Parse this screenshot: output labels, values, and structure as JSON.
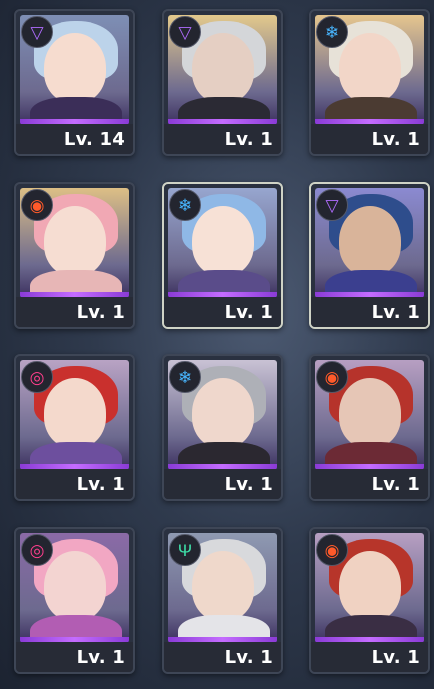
{
  "characters": [
    {
      "level": "Lv. 14",
      "element": "void-icon",
      "hair": "#bcd3ea",
      "skin": "#f6dccf",
      "body": "#3b2e58",
      "bg": "#7e8fb5"
    },
    {
      "level": "Lv. 1",
      "element": "void-icon",
      "hair": "#d4d6d9",
      "skin": "#e5cfc3",
      "body": "#2b2a34",
      "bg": "#e3c98c"
    },
    {
      "level": "Lv. 1",
      "element": "ice-icon",
      "hair": "#e7e2d8",
      "skin": "#f2d6c8",
      "body": "#4b3b32",
      "bg": "#e6c68e"
    },
    {
      "level": "Lv. 1",
      "element": "fire-icon",
      "hair": "#f1a8b4",
      "skin": "#f6ddd2",
      "body": "#e7b6b6",
      "bg": "#ddbf85"
    },
    {
      "level": "Lv. 1",
      "element": "ice-icon",
      "hair": "#8fb8e6",
      "skin": "#f7e1d6",
      "body": "#5a4c8a",
      "bg": "#97a6cf"
    },
    {
      "level": "Lv. 1",
      "element": "void-icon",
      "hair": "#2e4d8c",
      "skin": "#d9b49a",
      "body": "#3b3f8f",
      "bg": "#8b8ad1"
    },
    {
      "level": "Lv. 1",
      "element": "spiral-icon",
      "hair": "#c9302d",
      "skin": "#f4d9cc",
      "body": "#6d4f9e",
      "bg": "#b9a3c4"
    },
    {
      "level": "Lv. 1",
      "element": "ice-icon",
      "hair": "#aeb0b7",
      "skin": "#efd7cc",
      "body": "#2b2830",
      "bg": "#c9c2d4"
    },
    {
      "level": "Lv. 1",
      "element": "fire-icon",
      "hair": "#b6332b",
      "skin": "#e6c6b6",
      "body": "#6c2a35",
      "bg": "#b79fc2"
    },
    {
      "level": "Lv. 1",
      "element": "spiral-icon",
      "hair": "#f2a7c3",
      "skin": "#f3d4d1",
      "body": "#b25db3",
      "bg": "#8b6aa7"
    },
    {
      "level": "Lv. 1",
      "element": "wind-icon",
      "hair": "#d8d9dc",
      "skin": "#efd8cb",
      "body": "#e4e4e8",
      "bg": "#8f9ab2"
    },
    {
      "level": "Lv. 1",
      "element": "fire-icon",
      "hair": "#b7352a",
      "skin": "#f0d2c2",
      "body": "#3a2e44",
      "bg": "#b79fc2"
    }
  ],
  "element_colors": {
    "void-icon": "#b06cff",
    "ice-icon": "#48b6ff",
    "fire-icon": "#ff5a2a",
    "spiral-icon": "#ff3e8c",
    "wind-icon": "#3ee0a8"
  },
  "element_glyphs": {
    "void-icon": "▽",
    "ice-icon": "❄",
    "fire-icon": "◉",
    "spiral-icon": "◎",
    "wind-icon": "Ψ"
  }
}
